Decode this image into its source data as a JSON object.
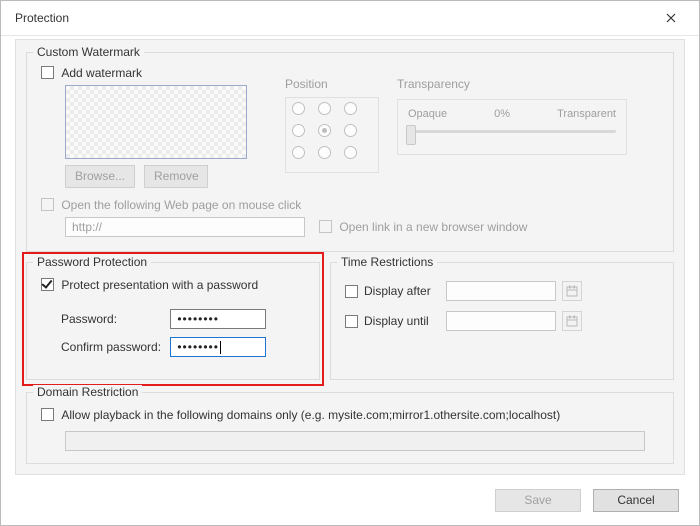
{
  "dialog": {
    "title": "Protection"
  },
  "watermark": {
    "legend": "Custom Watermark",
    "add_label": "Add watermark",
    "browse_label": "Browse...",
    "remove_label": "Remove",
    "position_label": "Position",
    "transparency": {
      "label": "Transparency",
      "left": "Opaque",
      "value": "0%",
      "right": "Transparent"
    },
    "open_web_label": "Open the following Web page on mouse click",
    "url_placeholder": "http://",
    "open_new_window_label": "Open link in a new browser window"
  },
  "password": {
    "legend": "Password Protection",
    "protect_label": "Protect presentation with a password",
    "password_label": "Password:",
    "confirm_label": "Confirm password:",
    "password_value": "••••••••",
    "confirm_value": "••••••••"
  },
  "time": {
    "legend": "Time Restrictions",
    "after_label": "Display after",
    "until_label": "Display until"
  },
  "domain": {
    "legend": "Domain Restriction",
    "allow_label": "Allow playback in the following domains only (e.g. mysite.com;mirror1.othersite.com;localhost)"
  },
  "footer": {
    "save": "Save",
    "cancel": "Cancel"
  }
}
